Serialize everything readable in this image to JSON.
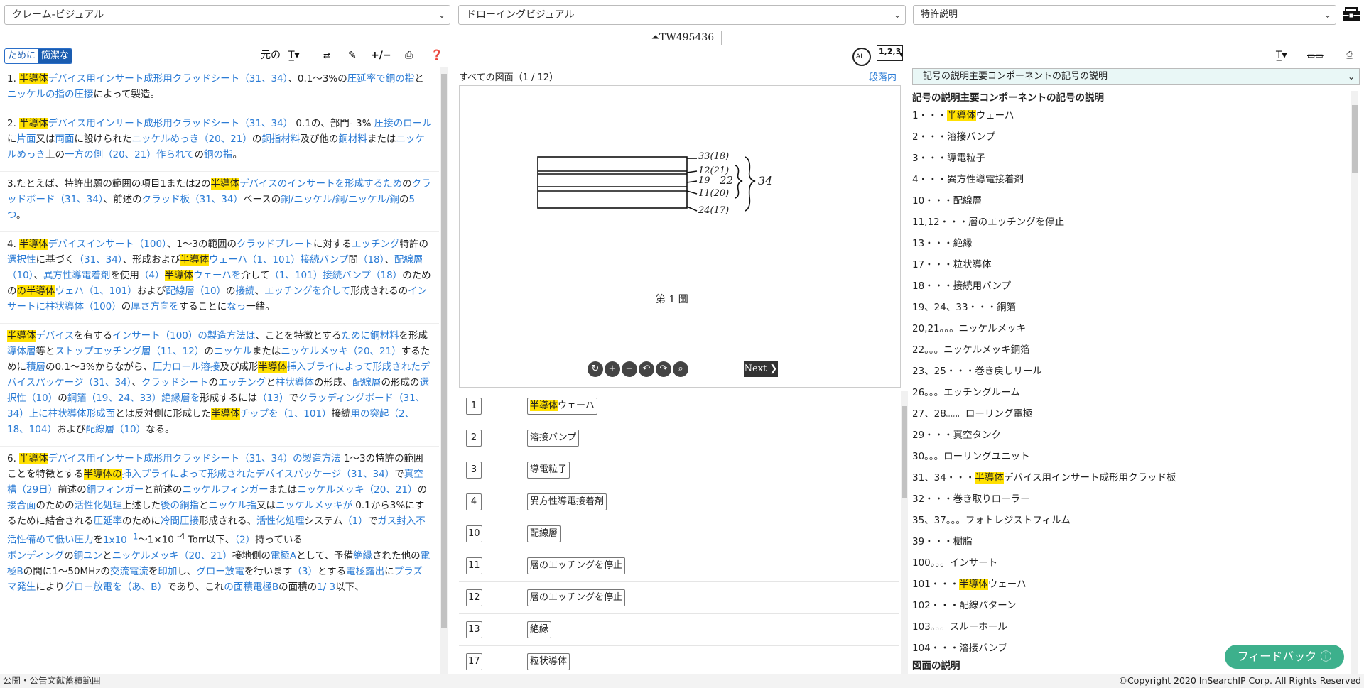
{
  "top": {
    "select1": "クレーム-ビジュアル",
    "select2": "ドローイングビジュアル",
    "select3": "特許説明",
    "patent_id": "TW495436"
  },
  "left": {
    "seg_on": "ために",
    "seg_off": "簡潔な",
    "orig_label": "元の",
    "claims": [
      {
        "html": "1. <span class=\"hl\">半導体</span><span class=\"lk\">デバイス用インサート成形用クラッドシート（31、34）</span>、0.1～3%の<span class=\"lk\">圧延率で銅の指</span>と<span class=\"lk\">ニッケルの指の圧接</span>によって製造。"
      },
      {
        "html": "2. <span class=\"hl\">半導体</span><span class=\"lk\">デバイス用インサート成形用クラッドシート（31、34）</span> 0.1の、部門- 3% <span class=\"lk\">圧接のロール</span>に<span class=\"lk\">片面</span>又は<span class=\"lk\">両面</span>に設けられた<span class=\"lk\">ニッケルめっき（20、21）</span>の<span class=\"lk\">銅指材料</span>及び他の<span class=\"lk\">銅材料</span>または<span class=\"lk\">ニッケルめっき</span>上の<span class=\"lk\">一方の側（20、21）作られて</span>の<span class=\"lk\">銅の指</span>。"
      },
      {
        "html": "3.たとえば、特許出願の範囲の項目1または2の<span class=\"hl\">半導体</span><span class=\"lk\">デバイスのインサートを形成するため</span>の<span class=\"lk\">クラッドボード（31、34）</span>、前述の<span class=\"lk\">クラッド板（31、34）</span>ベースの<span class=\"lk\">銅/ニッケル/銅/ニッケル/銅</span>の<span class=\"lk\">5つ</span>。"
      },
      {
        "html": "4. <span class=\"hl\">半導体</span><span class=\"lk\">デバイスインサート（100）</span>、1～3の範囲の<span class=\"lk\">クラッドプレート</span>に対する<span class=\"lk\">エッチング</span>特許の<span class=\"lk\">選択性</span>に基づく<span class=\"lk\">（31、34）</span>、形成および<span class=\"hl\">半導体</span><span class=\"lk\">ウェーハ（1、101）接続バンプ</span>間<span class=\"lk\">（18）</span>、<span class=\"lk\">配線層（10）</span>、<span class=\"lk\">異方性導電着剤</span>を使用<span class=\"lk\">（4）</span><span class=\"hl\">半導体</span><span class=\"lk\">ウェーハを</span>介して<span class=\"lk\">（1、101）接続バンプ（18）</span>のための<span class=\"hl\">の半導体</span><span class=\"lk\">ウェハ（1、101）</span>および<span class=\"lk\">配線層（10）</span>の<span class=\"lk\">接続</span>、<span class=\"lk\">エッチングを介して</span>形成されるの<span class=\"lk\">インサートに柱状導体（100）</span>の<span class=\"lk\">厚さ方向を</span>することに<span class=\"lk\">なっ</span>一緒。"
      },
      {
        "html": "<span class=\"hl\">半導体</span><span class=\"lk\">デバイス</span>を有する<span class=\"lk\">インサート（100）の製造方法は</span>、ことを特徴とする<span class=\"lk\">ために銅材料</span>を形成<span class=\"lk\">導体層</span>等と<span class=\"lk\">ストップエッチング層（11、12）</span>の<span class=\"lk\">ニッケル</span>または<span class=\"lk\">ニッケルメッキ（20、21）</span>するために<span class=\"lk\">積層</span>の0.1～3%からながら、<span class=\"lk\">圧力ロール溶接</span>及び成形<span class=\"hl\">半導体</span><span class=\"lk\">挿入プライによって形成されたデバイスパッケージ（31、34）</span>、<span class=\"lk\">クラッドシート</span>の<span class=\"lk\">エッチング</span>と<span class=\"lk\">柱状導体</span>の形成、<span class=\"lk\">配線層</span>の形成の<span class=\"lk\">選択性（10）</span>の<span class=\"lk\">銅箔（19、24、33）絶縁層を</span>形成するには<span class=\"lk\">（13）</span>で<span class=\"lk\">クラッディングボード（31、34）上に柱状導体形成面</span>とは反対側に形成した<span class=\"hl\">半導体</span><span class=\"lk\">チップを（1、101）</span>接続<span class=\"lk\">用の突起（2、18、104）</span>および<span class=\"lk\">配線層（10）</span>なる。"
      },
      {
        "html": "6. <span class=\"hl\">半導体</span><span class=\"lk\">デバイス用インサート成形用クラッドシート（31、34）の製造方法</span> 1～3の特許の範囲ことを特徴とする<span class=\"hl\">半導体の</span><span class=\"lk\">挿入プライによって形成されたデバイスパッケージ（31、34）</span>で<span class=\"lk\">真空槽（29日）</span>前述の<span class=\"lk\">銅フィンガー</span>と前述の<span class=\"lk\">ニッケルフィンガー</span>または<span class=\"lk\">ニッケルメッキ（20、21）</span>の<span class=\"lk\">接合面</span>のための<span class=\"lk\">活性化処理</span>上述した<span class=\"lk\">後の銅指</span>と<span class=\"lk\">ニッケル指</span>又は<span class=\"lk\">ニッケルメッキが</span> 0.1から3%にするために結合される<span class=\"lk\">圧延率</span>のために<span class=\"lk\">冷間圧接</span>形成される、<span class=\"lk\">活性化処理</span>システム<span class=\"lk\">（1）</span>で<span class=\"lk\">ガス封入不活性備めて低い圧力</span>を<span class=\"lk\">1x10 <sup>-1</sup></span>～1×10 <sup>-4</sup> Torr以下、<span class=\"lk\">（2）</span>持っている<br><span class=\"lk\">ボンディング</span>の<span class=\"lk\">銅ユン</span>と<span class=\"lk\">ニッケルメッキ（20、21）</span>接地側の<span class=\"lk\">電極A</span>として、予備<span class=\"lk\">絶縁</span>された他の<span class=\"lk\">電極B</span>の間に1～50MHzの<span class=\"lk\">交流電流</span>を<span class=\"lk\">印加</span>し、<span class=\"lk\">グロー放電</span>を行います<span class=\"lk\">（3）</span>とする<span class=\"lk\">電極露出</span>に<span class=\"lk\">プラズマ発生</span>により<span class=\"lk\">グロー放電を（あ、B）</span>であり、これ<span class=\"lk\">の面積電極B</span>の面積の<span class=\"lk\">1/ 3</span>以下、"
      }
    ]
  },
  "mid": {
    "title": "すべての図面（1 / 12）",
    "link": "段落内",
    "next_label": "Next",
    "figure_caption": "第 1 圖",
    "drawing_labels": [
      "33(18)",
      "12(21)",
      "19",
      "11(20)",
      "24(17)",
      "22",
      "34"
    ],
    "components": [
      {
        "num": "1",
        "html": "<span class=\"hl\">半導体</span>ウェーハ"
      },
      {
        "num": "2",
        "html": "溶接バンプ"
      },
      {
        "num": "3",
        "html": "導電粒子"
      },
      {
        "num": "4",
        "html": "異方性導電接着剤"
      },
      {
        "num": "10",
        "html": "配線層"
      },
      {
        "num": "11",
        "html": "層のエッチングを停止"
      },
      {
        "num": "12",
        "html": "層のエッチングを停止"
      },
      {
        "num": "13",
        "html": "絶縁"
      },
      {
        "num": "17",
        "html": "粒状導体"
      }
    ]
  },
  "right": {
    "select": "記号の説明主要コンポーネントの記号の説明",
    "heading": "記号の説明主要コンポーネントの記号の説明",
    "items": [
      {
        "html": "1・・・<span class=\"hl\">半導体</span>ウェーハ"
      },
      {
        "html": "2・・・溶接バンプ"
      },
      {
        "html": "3・・・導電粒子"
      },
      {
        "html": "4・・・異方性導電接着剤"
      },
      {
        "html": "10・・・配線層"
      },
      {
        "html": "11,12・・・層のエッチングを停止"
      },
      {
        "html": "13・・・絶縁"
      },
      {
        "html": "17・・・粒状導体"
      },
      {
        "html": "18・・・接続用バンプ"
      },
      {
        "html": "19、24、33・・・銅箔"
      },
      {
        "html": "20,21。。。ニッケルメッキ"
      },
      {
        "html": "22。。。ニッケルメッキ銅箔"
      },
      {
        "html": "23、25・・・巻き戻しリール"
      },
      {
        "html": "26。。。エッチングルーム"
      },
      {
        "html": "27、28。。。ローリング電極"
      },
      {
        "html": "29・・・真空タンク"
      },
      {
        "html": "30。。。ローリングユニット"
      },
      {
        "html": "31、34・・・<span class=\"hl\">半導体</span>デバイス用インサート成形用クラッド板"
      },
      {
        "html": "32・・・巻き取りローラー"
      },
      {
        "html": "35、37。。。フォトレジストフィルム"
      },
      {
        "html": "39・・・樹脂"
      },
      {
        "html": "100。。。インサート"
      },
      {
        "html": "101・・・<span class=\"hl\">半導体</span>ウェーハ"
      },
      {
        "html": "102・・・配線パターン"
      },
      {
        "html": "103。。。スルーホール"
      },
      {
        "html": "104・・・溶接バンプ"
      }
    ],
    "subheading": "図面の説明"
  },
  "footer": {
    "left": "公開・公告文献蓄積範囲",
    "right": "©Copyright 2020 InSearchIP Corp. All Rights Reserved"
  },
  "feedback": "フィードバック"
}
